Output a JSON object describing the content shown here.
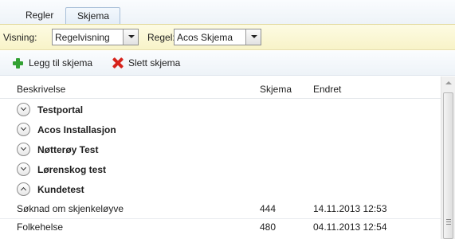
{
  "tabs": [
    {
      "label": "Regler",
      "active": false
    },
    {
      "label": "Skjema",
      "active": true
    }
  ],
  "filter": {
    "view_label": "Visning:",
    "view_value": "Regelvisning",
    "rule_label": "Regel:",
    "rule_value": "Acos Skjema"
  },
  "toolbar": {
    "add_label": "Legg til skjema",
    "add_icon": "plus-icon",
    "delete_label": "Slett skjema",
    "delete_icon": "delete-x-icon"
  },
  "grid": {
    "columns": [
      "Beskrivelse",
      "Skjema",
      "Endret"
    ],
    "groups": [
      {
        "label": "Testportal",
        "expanded": false
      },
      {
        "label": "Acos Installasjon",
        "expanded": false
      },
      {
        "label": "Nøtterøy Test",
        "expanded": false
      },
      {
        "label": "Lørenskog test",
        "expanded": false
      },
      {
        "label": "Kundetest",
        "expanded": true
      }
    ],
    "rows": [
      {
        "beskrivelse": "Søknad om skjenkeløyve",
        "skjema": "444",
        "endret": "14.11.2013 12:53"
      },
      {
        "beskrivelse": "Folkehelse",
        "skjema": "480",
        "endret": "04.11.2013 12:54"
      }
    ]
  },
  "colors": {
    "filter_bg": "#f8f3c8",
    "toolbar_bg": "#eef3f8",
    "add_icon": "#33a133",
    "delete_icon": "#d6231c"
  }
}
